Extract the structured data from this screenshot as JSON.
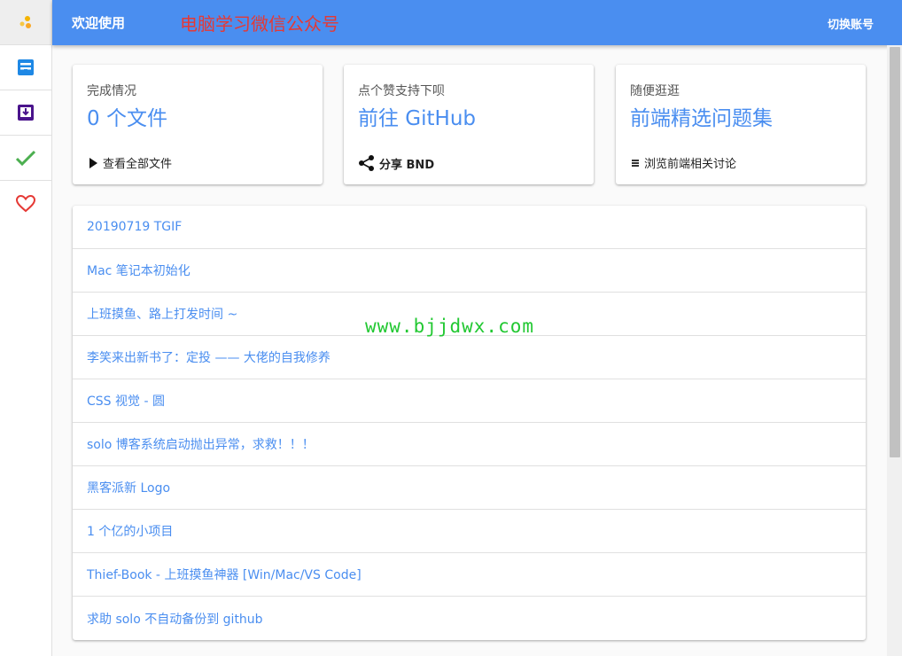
{
  "topbar": {
    "welcome": "欢迎使用",
    "promo": "电脑学习微信公众号",
    "switch_account": "切换账号"
  },
  "sidebar": {
    "items": [
      {
        "icon": "logo-dots-icon"
      },
      {
        "icon": "inbox-icon"
      },
      {
        "icon": "download-box-icon"
      },
      {
        "icon": "check-icon"
      },
      {
        "icon": "heart-icon"
      }
    ]
  },
  "cards": [
    {
      "caption": "完成情况",
      "big": "0 个文件",
      "action": "查看全部文件",
      "action_icon": "play-icon"
    },
    {
      "caption": "点个赞支持下呗",
      "big": "前往 GitHub",
      "action": "分享 BND",
      "action_icon": "share-icon"
    },
    {
      "caption": "随便逛逛",
      "big": "前端精选问题集",
      "action": "浏览前端相关讨论",
      "action_icon": "bars-icon"
    }
  ],
  "list": [
    "20190719 TGIF",
    "Mac 笔记本初始化",
    "上班摸鱼、路上打发时间 ~",
    "李笑来出新书了：定投 —— 大佬的自我修养",
    "CSS 视觉 - 圆",
    "solo 博客系统启动抛出异常，求救！！！",
    "黑客派新 Logo",
    "1 个亿的小项目",
    "Thief-Book - 上班摸鱼神器 [Win/Mac/VS Code]",
    "求助 solo 不自动备份到 github"
  ],
  "watermark": "www.bjjdwx.com",
  "colors": {
    "accent": "#4a8ef0",
    "promo": "#e53935",
    "check": "#4caf50",
    "heart": "#e53935",
    "inbox": "#1e88e5",
    "download": "#6a1b9a",
    "watermark": "#22c832"
  }
}
